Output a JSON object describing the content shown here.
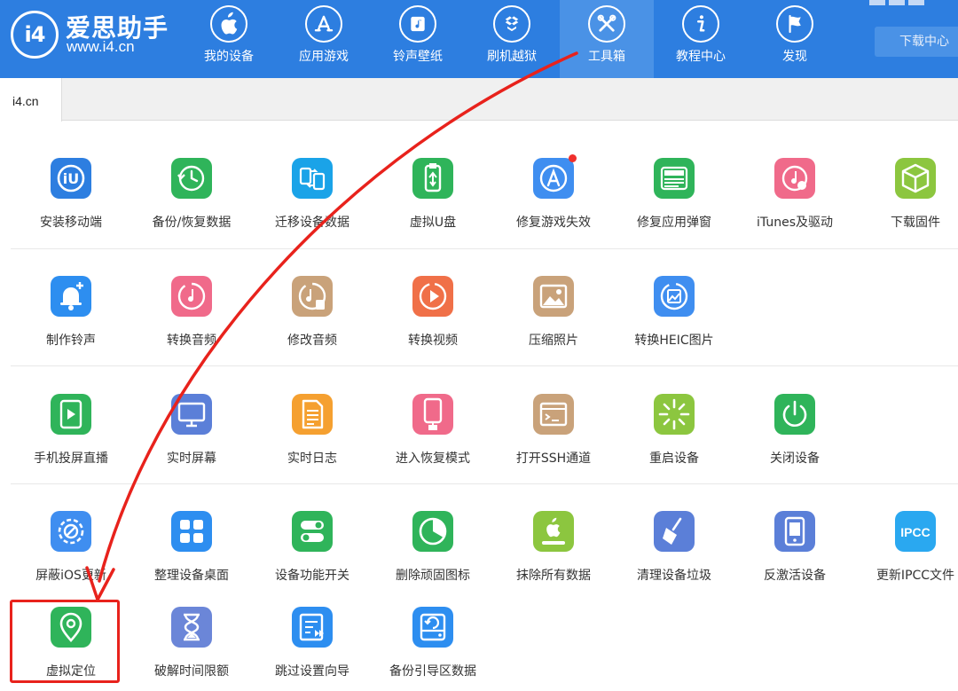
{
  "app": {
    "title": "爱思助手",
    "url": "www.i4.cn",
    "logo_glyph": "i4"
  },
  "nav": [
    {
      "label": "我的设备",
      "icon": "apple-icon"
    },
    {
      "label": "应用游戏",
      "icon": "app-store-icon"
    },
    {
      "label": "铃声壁纸",
      "icon": "ringtone-wallpaper-icon"
    },
    {
      "label": "刷机越狱",
      "icon": "dropbox-box-icon"
    },
    {
      "label": "工具箱",
      "icon": "tools-icon",
      "active": true
    },
    {
      "label": "教程中心",
      "icon": "info-icon"
    },
    {
      "label": "发现",
      "icon": "flag-icon"
    }
  ],
  "download_center": "下载中心",
  "tabs": [
    {
      "label": "i4.cn"
    }
  ],
  "tools": [
    {
      "label": "安装移动端",
      "icon": "i4-app-icon",
      "color": "#2d7ee0"
    },
    {
      "label": "备份/恢复数据",
      "icon": "backup-restore-icon",
      "color": "#2fb45a"
    },
    {
      "label": "迁移设备数据",
      "icon": "migrate-data-icon",
      "color": "#1aa3e8"
    },
    {
      "label": "虚拟U盘",
      "icon": "usb-drive-icon",
      "color": "#2fb45a"
    },
    {
      "label": "修复游戏失效",
      "icon": "app-store-repair-icon",
      "color": "#3f8ef0",
      "badge": true
    },
    {
      "label": "修复应用弹窗",
      "icon": "apple-id-icon",
      "color": "#2fb45a"
    },
    {
      "label": "iTunes及驱动",
      "icon": "itunes-icon",
      "color": "#f06a8a"
    },
    {
      "label": "下载固件",
      "icon": "firmware-box-icon",
      "color": "#8cc63f"
    },
    {
      "label": "制作铃声",
      "icon": "bell-icon",
      "color": "#2d8ef0"
    },
    {
      "label": "转换音频",
      "icon": "music-convert-icon",
      "color": "#f06a8a"
    },
    {
      "label": "修改音频",
      "icon": "music-edit-icon",
      "color": "#c9a27a"
    },
    {
      "label": "转换视频",
      "icon": "video-play-icon",
      "color": "#f07048"
    },
    {
      "label": "压缩照片",
      "icon": "photo-icon",
      "color": "#c9a27a"
    },
    {
      "label": "转换HEIC图片",
      "icon": "heic-convert-icon",
      "color": "#3f8ef0"
    },
    {
      "label": "手机投屏直播",
      "icon": "screen-cast-icon",
      "color": "#2fb45a"
    },
    {
      "label": "实时屏幕",
      "icon": "monitor-icon",
      "color": "#5b7fd8"
    },
    {
      "label": "实时日志",
      "icon": "log-document-icon",
      "color": "#f5a030"
    },
    {
      "label": "进入恢复模式",
      "icon": "recovery-mode-icon",
      "color": "#f06a8a"
    },
    {
      "label": "打开SSH通道",
      "icon": "ssh-terminal-icon",
      "color": "#c9a27a"
    },
    {
      "label": "重启设备",
      "icon": "restart-icon",
      "color": "#8cc63f"
    },
    {
      "label": "关闭设备",
      "icon": "power-icon",
      "color": "#2fb45a"
    },
    {
      "label": "屏蔽iOS更新",
      "icon": "block-update-icon",
      "color": "#3f8ef0"
    },
    {
      "label": "整理设备桌面",
      "icon": "grid-desktop-icon",
      "color": "#2d8ef0"
    },
    {
      "label": "设备功能开关",
      "icon": "toggle-switch-icon",
      "color": "#2fb45a"
    },
    {
      "label": "删除顽固图标",
      "icon": "pie-delete-icon",
      "color": "#2fb45a"
    },
    {
      "label": "抹除所有数据",
      "icon": "erase-apple-icon",
      "color": "#8cc63f"
    },
    {
      "label": "清理设备垃圾",
      "icon": "broom-clean-icon",
      "color": "#5b7fd8"
    },
    {
      "label": "反激活设备",
      "icon": "deactivate-device-icon",
      "color": "#5b7fd8"
    },
    {
      "label": "更新IPCC文件",
      "icon": "ipcc-icon",
      "color": "#2aa8f0",
      "text": "IPCC"
    },
    {
      "label": "虚拟定位",
      "icon": "location-pin-icon",
      "color": "#2fb45a"
    },
    {
      "label": "破解时间限额",
      "icon": "hourglass-icon",
      "color": "#6b86d8"
    },
    {
      "label": "跳过设置向导",
      "icon": "skip-guide-icon",
      "color": "#2d8ef0"
    },
    {
      "label": "备份引导区数据",
      "icon": "disk-backup-icon",
      "color": "#2d8ef0"
    }
  ],
  "colors": {
    "header": "#2d7ee0",
    "active_nav": "#4a92e6",
    "annotation": "#e8221c"
  }
}
